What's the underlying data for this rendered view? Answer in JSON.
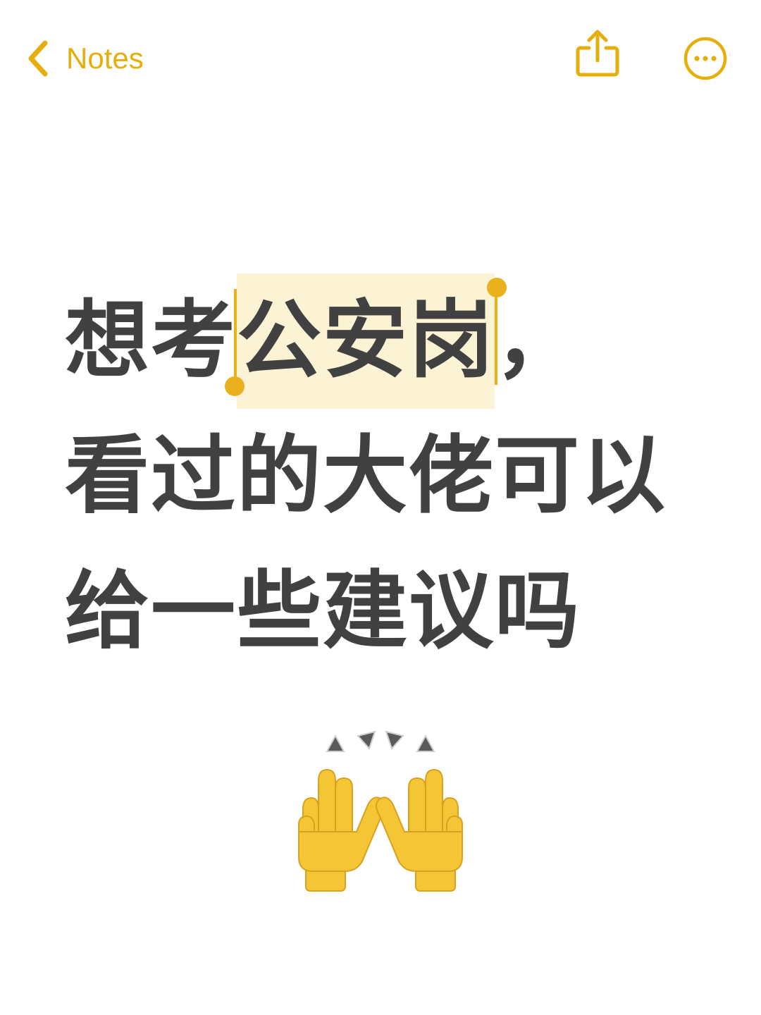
{
  "navbar": {
    "back_label": "Notes",
    "accent_color": "#E6AE0B",
    "icons": [
      "chevron-left-icon",
      "share-icon",
      "more-icon"
    ]
  },
  "note": {
    "line1_before": "想考",
    "line1_selected": "公安岗",
    "line1_after": "，",
    "line2": "看过的大佬可以",
    "line3": "给一些建议吗",
    "text_color": "#414141",
    "selection_color": "#FCF3D5"
  },
  "emoji": {
    "name": "raising-hands"
  }
}
